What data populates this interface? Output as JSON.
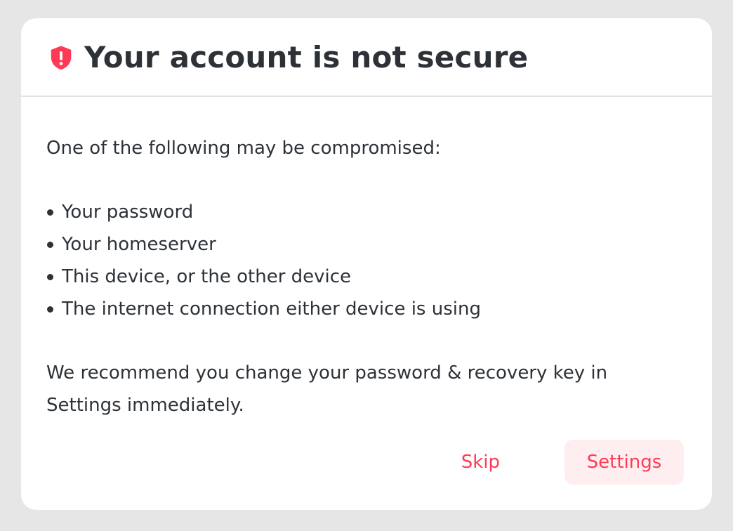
{
  "dialog": {
    "title": "Your account is not secure",
    "title_icon": "shield-alert-icon",
    "intro": "One of the following may be compromised:",
    "issues": [
      "Your password",
      "Your homeserver",
      "This device, or the other device",
      "The internet connection either device is using"
    ],
    "recommendation": "We recommend you change your password & recovery key in Settings immediately.",
    "buttons": {
      "skip": "Skip",
      "settings": "Settings"
    }
  },
  "colors": {
    "accent": "#ff3a56",
    "accent_bg": "#ffeef0",
    "text": "#2d3238",
    "page_bg": "#e6e6e6"
  }
}
